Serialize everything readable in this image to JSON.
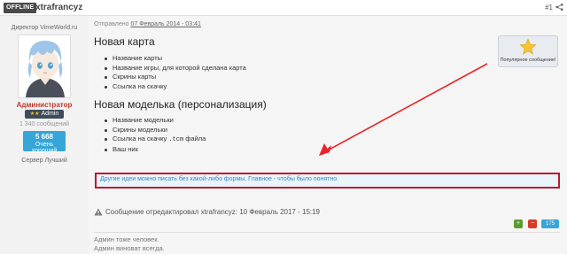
{
  "header": {
    "status": "OFFLINE",
    "username": "xtrafrancyz",
    "post_number": "#1"
  },
  "author": {
    "title": "Директор VimeWorld.ru",
    "role": "Администратор",
    "badge_stars": "★★",
    "badge": "Admin",
    "messages": "1 340 сообщений",
    "rep_value": "5 668",
    "rep_label": "Очень хороший",
    "server": "Сервер Лучший"
  },
  "post": {
    "posted_prefix": "Отправлено",
    "posted_date": "07 Февраль 2014 - 03:41",
    "popular_label": "Популярное сообщение!",
    "heading1": "Новая карта",
    "list1": [
      "Название карты",
      "Название игры, для которой сделана карта",
      "Скрины карты",
      "Ссылка на скачку"
    ],
    "heading2": "Новая моделька (персонализация)",
    "list2": [
      "Название модельки",
      "Скрины модельки",
      "Ссылка на скачку",
      "Ваш ник"
    ],
    "list2_code_prefix": ".tcm",
    "list2_code_suffix": "файла",
    "note": "Другие идеи можно писать без какой-либо формы. Главное - чтобы было понятно.",
    "edited": "Сообщение отредактировал xtrafrancyz: 10 Февраль 2017 - 15:19",
    "vote_up": "+",
    "vote_down": "−",
    "vote_count": "175",
    "signature": [
      "Админ тоже человек.",
      "Админ виноват всегда."
    ]
  },
  "colors": {
    "accent": "#36a5d8",
    "role": "#c0392b",
    "highlight_border": "#c0172a",
    "link": "#3a87c8"
  },
  "icons": {
    "share": "share-icon",
    "star": "star-icon",
    "warning": "warning-icon",
    "arrow": "arrow-annotation"
  }
}
